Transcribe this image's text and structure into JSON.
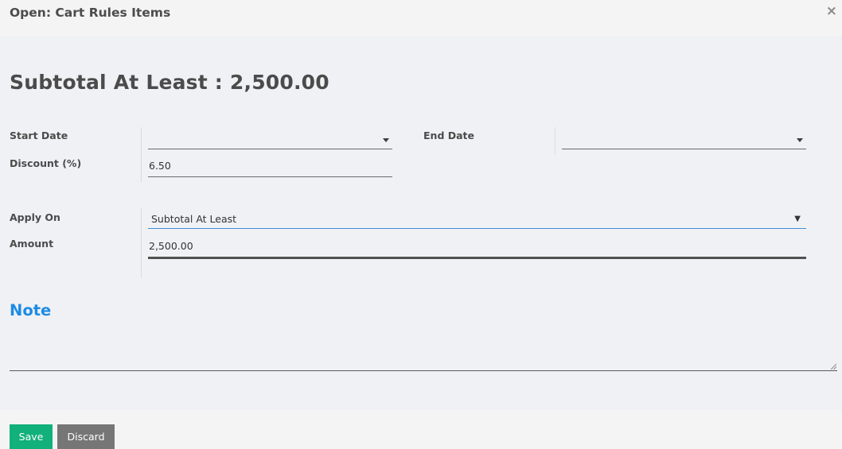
{
  "dialog": {
    "title": "Open: Cart Rules Items",
    "close_glyph": "×"
  },
  "record": {
    "title": "Subtotal At Least : 2,500.00"
  },
  "fields": {
    "start_date": {
      "label": "Start Date",
      "value": ""
    },
    "end_date": {
      "label": "End Date",
      "value": ""
    },
    "discount": {
      "label": "Discount (%)",
      "value": "6.50"
    },
    "apply_on": {
      "label": "Apply On",
      "value": "Subtotal At Least"
    },
    "amount": {
      "label": "Amount",
      "value": "2,500.00"
    }
  },
  "note": {
    "title": "Note",
    "value": ""
  },
  "footer": {
    "save_label": "Save",
    "discard_label": "Discard"
  },
  "colors": {
    "save": "#12b07a",
    "discard": "#767676",
    "note_heading": "#1d8ce6",
    "focus_underline": "#3f8fd8"
  }
}
